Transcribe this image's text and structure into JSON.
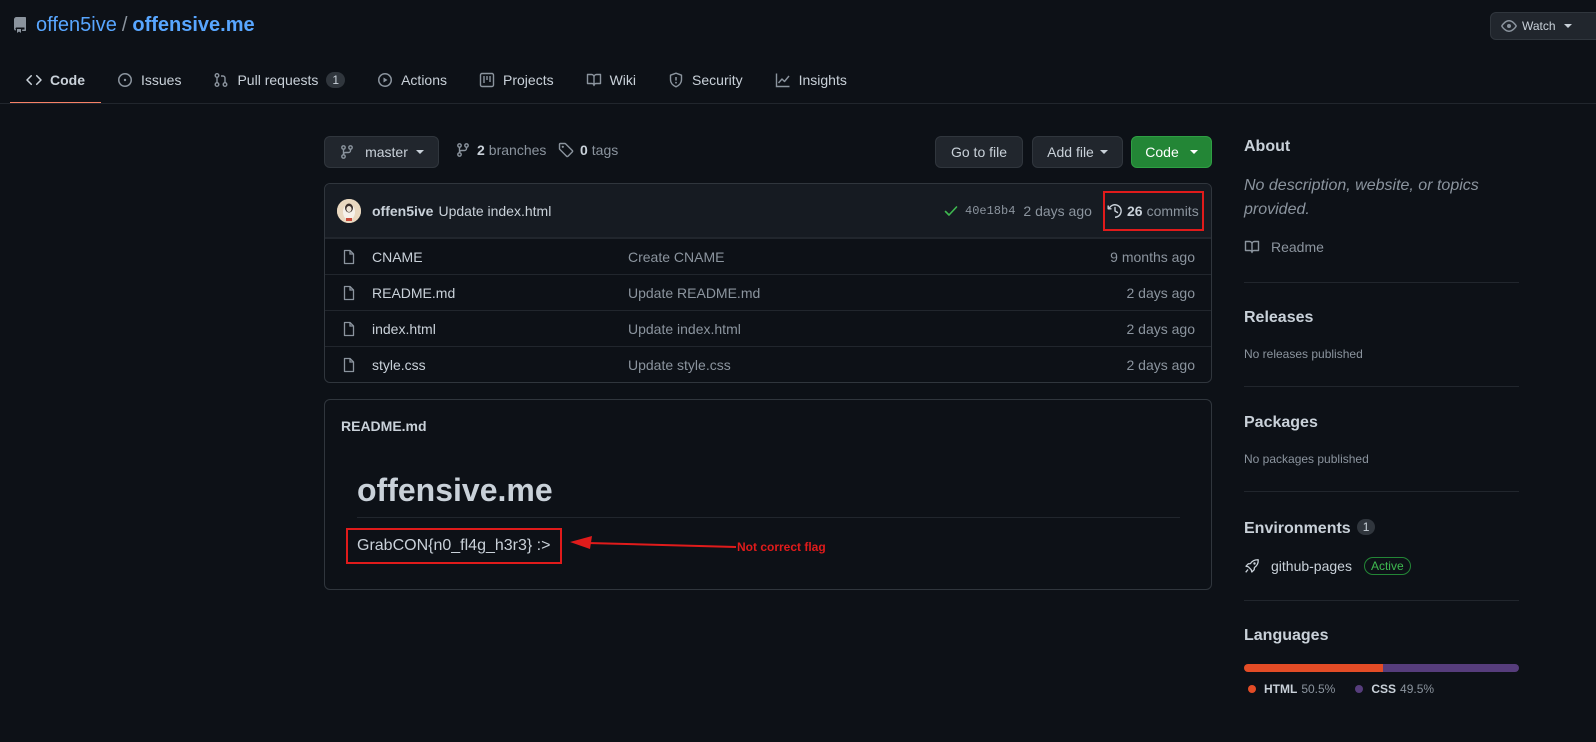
{
  "repo": {
    "owner": "offen5ive",
    "separator": "/",
    "name": "offensive.me"
  },
  "watch": {
    "label": "Watch"
  },
  "tabs": [
    {
      "label": "Code",
      "icon": "code-icon",
      "active": true
    },
    {
      "label": "Issues",
      "icon": "issue-opened-icon"
    },
    {
      "label": "Pull requests",
      "icon": "git-pull-request-icon",
      "count": "1"
    },
    {
      "label": "Actions",
      "icon": "play-icon"
    },
    {
      "label": "Projects",
      "icon": "project-icon"
    },
    {
      "label": "Wiki",
      "icon": "book-icon"
    },
    {
      "label": "Security",
      "icon": "shield-icon"
    },
    {
      "label": "Insights",
      "icon": "graph-icon"
    }
  ],
  "branchbar": {
    "branch": "master",
    "branches_count": "2",
    "branches_label": "branches",
    "tags_count": "0",
    "tags_label": "tags",
    "go_to_file": "Go to file",
    "add_file": "Add file",
    "code": "Code"
  },
  "commit": {
    "author": "offen5ive",
    "message": "Update index.html",
    "sha": "40e18b4",
    "age": "2 days ago",
    "commits_count": "26",
    "commits_label": "commits",
    "status_color": "#3fb950"
  },
  "files": [
    {
      "name": "CNAME",
      "message": "Create CNAME",
      "age": "9 months ago"
    },
    {
      "name": "README.md",
      "message": "Update README.md",
      "age": "2 days ago"
    },
    {
      "name": "index.html",
      "message": "Update index.html",
      "age": "2 days ago"
    },
    {
      "name": "style.css",
      "message": "Update style.css",
      "age": "2 days ago"
    }
  ],
  "readme": {
    "filename": "README.md",
    "heading": "offensive.me",
    "flag_text": "GrabCON{n0_fl4g_h3r3} :>",
    "annotation": "Not correct flag",
    "annotation_color": "#e01b1b"
  },
  "sidebar": {
    "about": {
      "title": "About",
      "description": "No description, website, or topics provided.",
      "readme_link": "Readme"
    },
    "releases": {
      "title": "Releases",
      "text": "No releases published"
    },
    "packages": {
      "title": "Packages",
      "text": "No packages published"
    },
    "environments": {
      "title": "Environments",
      "count": "1",
      "items": [
        {
          "name": "github-pages",
          "badge": "Active"
        }
      ]
    },
    "languages": {
      "title": "Languages",
      "items": [
        {
          "name": "HTML",
          "percent": "50.5%",
          "value": 50.5,
          "color": "#e34c26"
        },
        {
          "name": "CSS",
          "percent": "49.5%",
          "value": 49.5,
          "color": "#563d7c"
        }
      ]
    }
  },
  "colors": {
    "accent_link": "#58a6ff",
    "tab_underline": "#f78166",
    "green_button": "#238636",
    "annotation_red": "#e01b1b"
  }
}
